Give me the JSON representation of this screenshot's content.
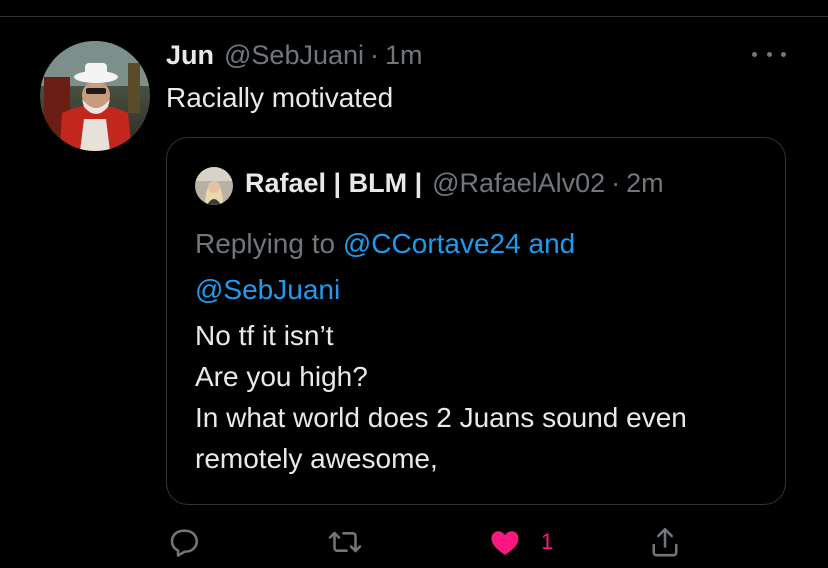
{
  "tweet": {
    "author_name": "Jun",
    "author_handle": "@SebJuani",
    "separator": "·",
    "time": "1m",
    "text": "Racially motivated"
  },
  "quoted_tweet": {
    "author_name": "Rafael | BLM |",
    "author_handle": "@RafaelAlv02",
    "separator": "·",
    "time": "2m",
    "replying_prefix": "Replying to",
    "replying_mention_1": "@CCortave24",
    "replying_and": "and",
    "replying_mention_2": "@SebJuani",
    "lines": [
      "No tf it isn’t",
      "Are you high?",
      "In what world does 2 Juans sound even",
      "remotely awesome,"
    ]
  },
  "actions": {
    "like_count": "1"
  },
  "icons": {
    "more": "more-horizontal-icon",
    "reply": "reply-bubble-icon",
    "retweet": "retweet-icon",
    "like": "heart-icon",
    "share": "share-icon"
  },
  "colors": {
    "background": "#000000",
    "text": "#e7e9ea",
    "secondary": "#71767b",
    "link": "#1d9bf0",
    "like": "#f91880",
    "border": "#2f3336"
  }
}
